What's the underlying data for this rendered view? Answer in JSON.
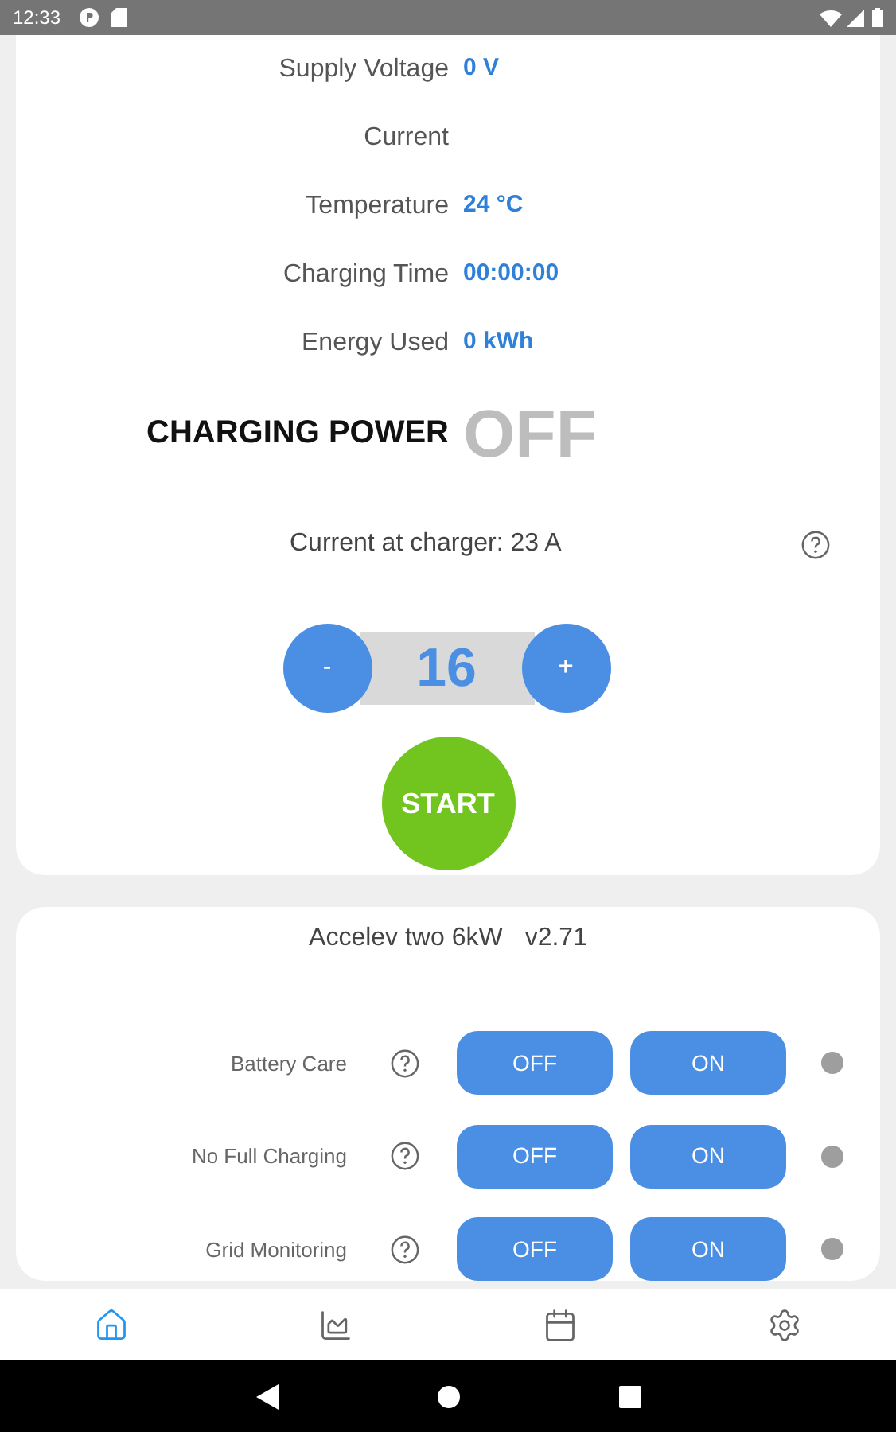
{
  "status_bar": {
    "time": "12:33"
  },
  "readings": [
    {
      "label": "Supply Voltage",
      "value": "0 V"
    },
    {
      "label": "Current"
    },
    {
      "label": "Temperature",
      "value": "24 °C"
    },
    {
      "label": "Charging Time",
      "value": "00:00:00"
    },
    {
      "label": "Energy Used",
      "value": "0 kWh"
    }
  ],
  "charging_power": {
    "label": "CHARGING POWER",
    "value": "OFF"
  },
  "current_at_charger": "Current at charger: 23 A",
  "stepper": {
    "minus": "-",
    "value": "16",
    "plus": "+"
  },
  "start_button": "START",
  "device": {
    "name": "Accelev two 6kW",
    "version": "v2.71"
  },
  "settings": [
    {
      "label": "Battery Care",
      "off": "OFF",
      "on": "ON"
    },
    {
      "label": "No Full Charging",
      "off": "OFF",
      "on": "ON"
    },
    {
      "label": "Grid Monitoring",
      "off": "OFF",
      "on": "ON"
    }
  ],
  "bottom_nav": [
    {
      "kind": "home",
      "selected": true
    },
    {
      "kind": "chart",
      "selected": false
    },
    {
      "kind": "calendar",
      "selected": false
    },
    {
      "kind": "settings",
      "selected": false
    }
  ]
}
